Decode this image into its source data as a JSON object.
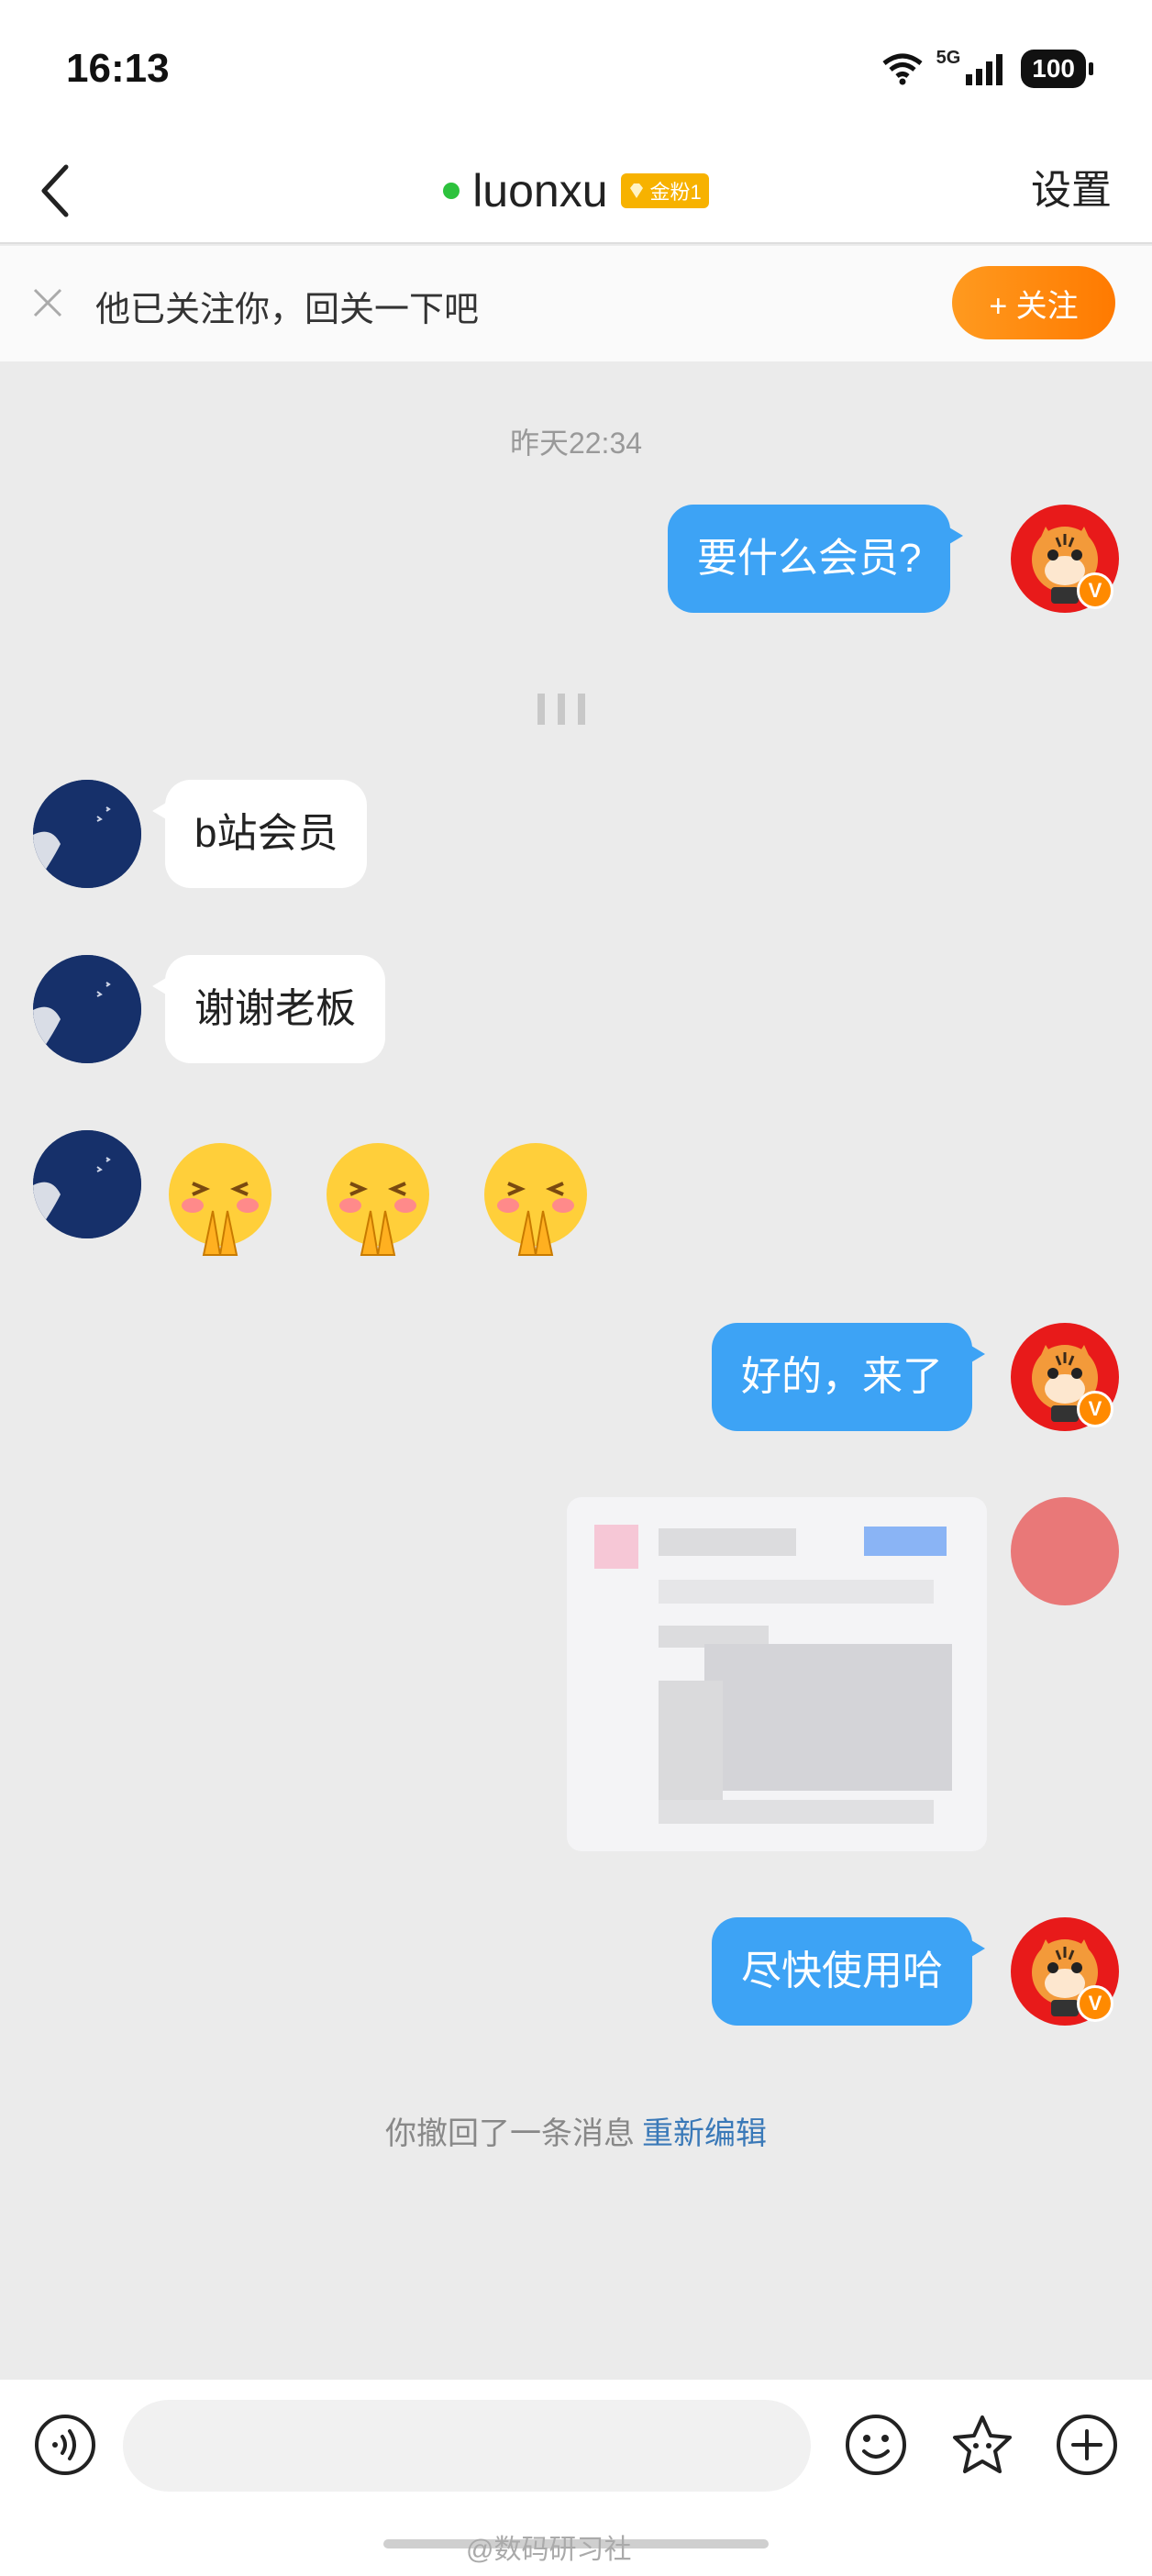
{
  "status_bar": {
    "time": "16:13",
    "network": "5G",
    "battery": "100"
  },
  "header": {
    "contact_name": "luonxu",
    "fan_badge": "金粉1",
    "settings_label": "设置"
  },
  "follow_bar": {
    "text": "他已关注你，回关一下吧",
    "button_label": "+ 关注"
  },
  "chat": {
    "timestamp": "昨天22:34",
    "messages": [
      {
        "from": "me",
        "type": "text",
        "text": "要什么会员?"
      },
      {
        "from": "them",
        "type": "text",
        "text": "b站会员"
      },
      {
        "from": "them",
        "type": "text",
        "text": "谢谢老板"
      },
      {
        "from": "them",
        "type": "emoji",
        "count": 3,
        "icon": "pray-blush-face"
      },
      {
        "from": "me",
        "type": "text",
        "text": "好的，来了"
      },
      {
        "from": "me",
        "type": "image",
        "note": "blurred screenshot"
      },
      {
        "from": "me",
        "type": "text",
        "text": "尽快使用哈"
      }
    ],
    "recall_notice": "你撤回了一条消息",
    "recall_action": "重新编辑"
  },
  "bottom_bar": {
    "watermark": "@数码研习社"
  },
  "colors": {
    "accent": "#3da3f5",
    "follow": "#ff8a00",
    "online": "#2dc23d",
    "badge": "#f7b200"
  }
}
